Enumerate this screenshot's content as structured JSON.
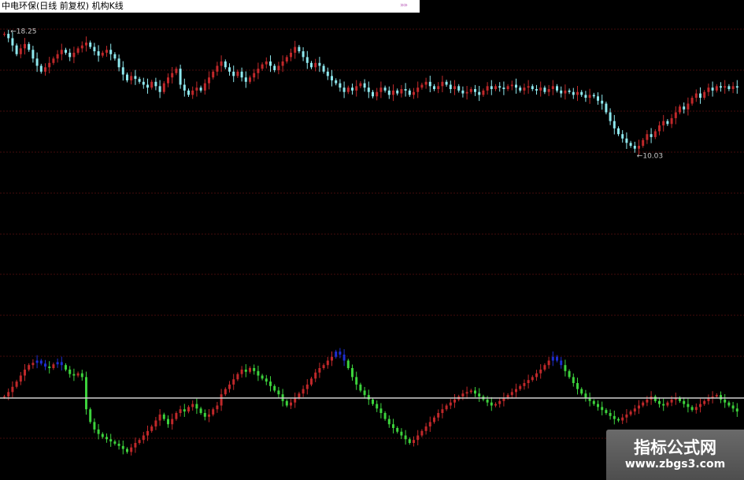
{
  "title": "中电环保(日线 前复权) 机构K线",
  "title_marker": "»»",
  "watermark": {
    "main": "指标公式网",
    "url": "www.zbgs3.com"
  },
  "colors": {
    "background": "#000000",
    "up": "#c0282a",
    "down": "#8ee8ee",
    "indicator_down": "#3cd23c",
    "indicator_peak": "#1e2ed0",
    "zero_line": "#d0d0d0",
    "grid": "#7a1818"
  },
  "chart_data": [
    {
      "type": "candlestick",
      "title": "中电环保(日线 前复权) 机构K线",
      "annotations": [
        {
          "label": "18.25",
          "kind": "high",
          "bar": 1
        },
        {
          "label": "10.03",
          "kind": "low",
          "bar": 154
        }
      ],
      "ylim": [
        7.3,
        18.9
      ],
      "grid": "horizontal dashed",
      "close": [
        18.2,
        17.9,
        17.4,
        16.8,
        17.2,
        17.5,
        17.1,
        16.5,
        16.0,
        15.6,
        15.9,
        16.2,
        16.5,
        16.8,
        17.1,
        16.9,
        16.6,
        16.9,
        17.2,
        17.4,
        17.6,
        17.3,
        17.0,
        16.7,
        16.9,
        17.1,
        16.8,
        16.5,
        15.9,
        15.4,
        15.0,
        15.3,
        15.1,
        14.9,
        14.7,
        14.5,
        14.9,
        14.6,
        14.2,
        14.8,
        15.2,
        15.5,
        15.8,
        14.7,
        14.3,
        14.0,
        14.3,
        14.5,
        14.3,
        14.8,
        15.2,
        15.6,
        16.0,
        16.3,
        15.9,
        15.6,
        15.3,
        15.6,
        15.2,
        14.9,
        15.2,
        15.5,
        15.8,
        16.1,
        16.3,
        16.0,
        15.7,
        16.0,
        16.3,
        16.6,
        16.9,
        17.3,
        17.0,
        16.6,
        16.2,
        15.9,
        16.2,
        16.0,
        15.6,
        15.3,
        15.0,
        14.8,
        14.5,
        14.2,
        14.5,
        14.3,
        14.6,
        14.8,
        14.5,
        14.2,
        13.9,
        14.2,
        14.5,
        14.3,
        14.0,
        14.3,
        14.1,
        14.4,
        14.3,
        14.0,
        14.2,
        14.5,
        14.7,
        14.9,
        14.6,
        14.4,
        14.6,
        14.9,
        14.7,
        14.4,
        14.6,
        14.3,
        14.1,
        14.2,
        14.4,
        14.2,
        14.0,
        14.3,
        14.6,
        14.4,
        14.6,
        14.5,
        14.4,
        14.6,
        14.7,
        14.5,
        14.3,
        14.5,
        14.6,
        14.4,
        14.3,
        14.5,
        14.2,
        14.4,
        14.6,
        14.3,
        14.1,
        14.3,
        14.2,
        14.0,
        14.2,
        14.0,
        13.8,
        14.0,
        13.9,
        13.6,
        13.4,
        12.8,
        12.2,
        11.7,
        11.3,
        11.0,
        10.7,
        10.5,
        10.3,
        10.5,
        10.9,
        11.3,
        11.1,
        11.5,
        11.9,
        12.2,
        12.0,
        12.4,
        12.8,
        13.2,
        13.0,
        13.4,
        13.8,
        14.1,
        13.8,
        14.2,
        14.5,
        14.3,
        14.6,
        14.5,
        14.6,
        14.4,
        14.6,
        14.5
      ]
    },
    {
      "type": "candlestick",
      "title": "",
      "ylim": [
        -100,
        100
      ],
      "baseline": 0,
      "close": [
        2,
        8,
        15,
        22,
        30,
        38,
        44,
        47,
        50,
        46,
        42,
        40,
        45,
        48,
        44,
        38,
        32,
        30,
        33,
        28,
        -15,
        -32,
        -42,
        -48,
        -52,
        -55,
        -58,
        -61,
        -64,
        -68,
        -72,
        -66,
        -60,
        -56,
        -50,
        -44,
        -38,
        -30,
        -22,
        -28,
        -35,
        -28,
        -20,
        -15,
        -18,
        -12,
        -8,
        -14,
        -20,
        -25,
        -22,
        -15,
        -10,
        5,
        12,
        18,
        25,
        32,
        38,
        35,
        40,
        36,
        30,
        26,
        22,
        16,
        10,
        5,
        -4,
        -10,
        -6,
        0,
        6,
        12,
        18,
        26,
        34,
        40,
        44,
        50,
        55,
        62,
        58,
        50,
        40,
        28,
        18,
        10,
        4,
        -2,
        -8,
        -14,
        -20,
        -28,
        -35,
        -40,
        -45,
        -50,
        -55,
        -60,
        -56,
        -50,
        -44,
        -38,
        -32,
        -26,
        -20,
        -15,
        -10,
        -6,
        -2,
        2,
        6,
        8,
        10,
        6,
        2,
        -2,
        -6,
        -10,
        -8,
        -4,
        0,
        4,
        8,
        12,
        16,
        20,
        24,
        28,
        33,
        38,
        44,
        50,
        55,
        50,
        44,
        36,
        28,
        20,
        12,
        6,
        0,
        -4,
        -8,
        -12,
        -16,
        -20,
        -24,
        -28,
        -30,
        -26,
        -22,
        -18,
        -14,
        -10,
        -6,
        -2,
        2,
        -4,
        -8,
        -10,
        -6,
        -2,
        0,
        -4,
        -8,
        -12,
        -16,
        -12,
        -8,
        -4,
        0,
        2,
        4,
        -2,
        -6,
        -10,
        -14,
        -18
      ]
    }
  ]
}
